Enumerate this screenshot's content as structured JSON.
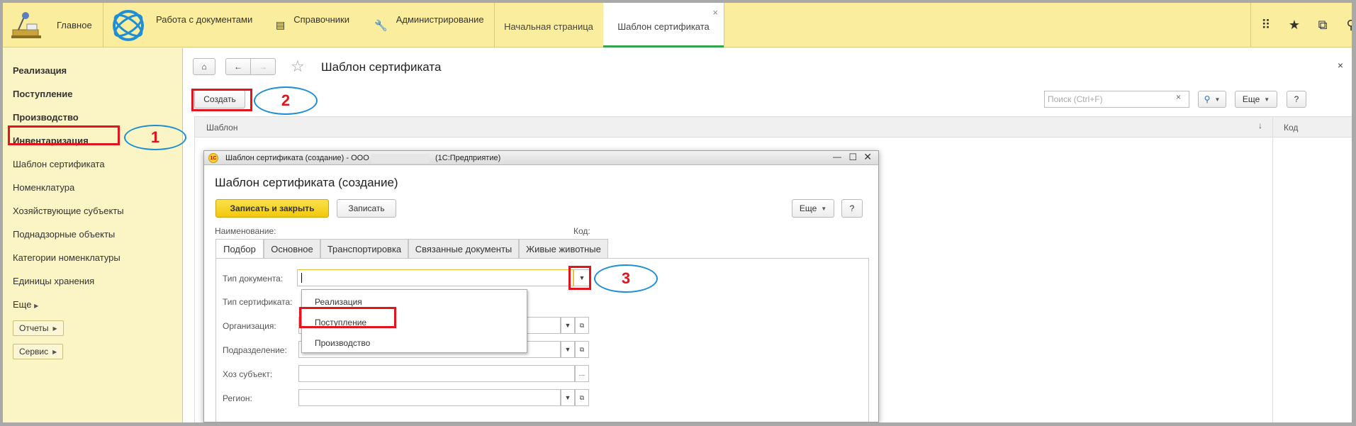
{
  "topbar": {
    "home_label": "Главное",
    "sections": [
      "Работа с документами",
      "Справочники",
      "Администрирование"
    ],
    "open_tabs": [
      "Начальная страница",
      "Шаблон сертификата"
    ],
    "close_glyph": "×"
  },
  "sidebar": {
    "bold_items": [
      "Реализация",
      "Поступление",
      "Производство",
      "Инвентаризация"
    ],
    "items": [
      "Шаблон сертификата",
      "Номенклатура",
      "Хозяйствующие субъекты",
      "Поднадзорные объекты",
      "Категории номенклатуры",
      "Единицы хранения"
    ],
    "more_label": "Еще",
    "reports_label": "Отчеты",
    "service_label": "Сервис"
  },
  "main": {
    "title": "Шаблон сертификата",
    "create_label": "Создать",
    "search_placeholder": "Поиск (Ctrl+F)",
    "more_label": "Еще",
    "help_label": "?",
    "columns": [
      "Шаблон",
      "Код"
    ],
    "sort_glyph": "↓"
  },
  "dialog": {
    "window_title": "Шаблон сертификата (создание) - ООО",
    "window_title_suffix": "(1С:Предприятие)",
    "heading": "Шаблон сертификата (создание)",
    "save_close_label": "Записать и закрыть",
    "save_label": "Записать",
    "more_label": "Еще",
    "help_label": "?",
    "name_label": "Наименование:",
    "code_label": "Код:",
    "tabs": [
      "Подбор",
      "Основное",
      "Транспортировка",
      "Связанные документы",
      "Живые животные"
    ],
    "fields": [
      "Тип документа:",
      "Тип сертификата:",
      "Организация:",
      "Подразделение:",
      "Хоз субъект:",
      "Регион:"
    ],
    "dropdown_options": [
      "Реализация",
      "Поступление",
      "Производство"
    ]
  },
  "annotations": [
    "1",
    "2",
    "3"
  ],
  "colors": {
    "topbar": "#fbed9e",
    "sidebar": "#fbf4c4",
    "accent_green": "#31a44c",
    "primary_button": "#f5d11c",
    "callout_blue": "#1c8ed8",
    "highlight_red": "#e3141b"
  }
}
